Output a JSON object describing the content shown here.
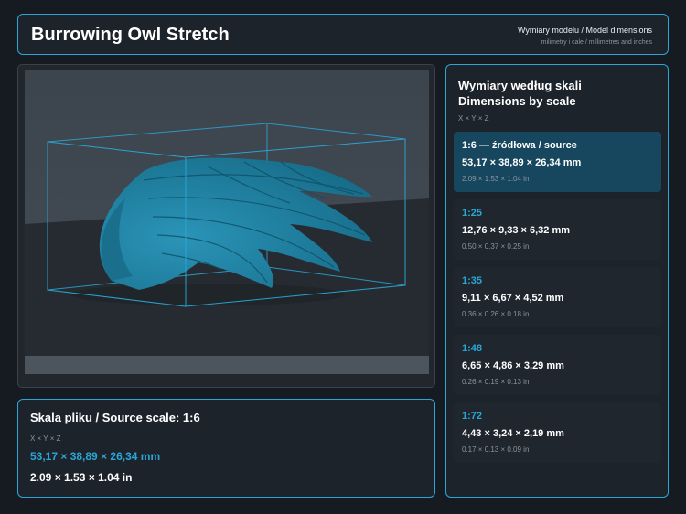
{
  "header": {
    "title": "Burrowing Owl Stretch",
    "subtitle": "Wymiary modelu / Model dimensions",
    "units_note": "milimetry i cale / millimetres and inches"
  },
  "source": {
    "title": "Skala pliku / Source scale: 1:6",
    "axes": "X × Y × Z",
    "mm": "53,17 × 38,89 × 26,34 mm",
    "inches": "2.09 × 1.53 × 1.04 in"
  },
  "scales": {
    "title_pl": "Wymiary według skali",
    "title_en": "Dimensions by scale",
    "axes": "X × Y × Z",
    "items": [
      {
        "ratio": "1:6  —  źródłowa / source",
        "mm": "53,17 × 38,89 × 26,34 mm",
        "inches": "2.09 × 1.53 × 1.04 in",
        "active": true
      },
      {
        "ratio": "1:25",
        "mm": "12,76 × 9,33 × 6,32 mm",
        "inches": "0.50 × 0.37 × 0.25 in",
        "active": false
      },
      {
        "ratio": "1:35",
        "mm": "9,11 × 6,67 × 4,52 mm",
        "inches": "0.36 × 0.26 × 0.18 in",
        "active": false
      },
      {
        "ratio": "1:48",
        "mm": "6,65 × 4,86 × 3,29 mm",
        "inches": "0.26 × 0.19 × 0.13 in",
        "active": false
      },
      {
        "ratio": "1:72",
        "mm": "4,43 × 3,24 × 2,19 mm",
        "inches": "0.17 × 0.13 × 0.09 in",
        "active": false
      }
    ]
  },
  "colors": {
    "accent": "#2aa6d6",
    "model": "#1e7f9e",
    "background": "#161b22"
  },
  "icons": {
    "model_preview": "owl-wing-model"
  }
}
